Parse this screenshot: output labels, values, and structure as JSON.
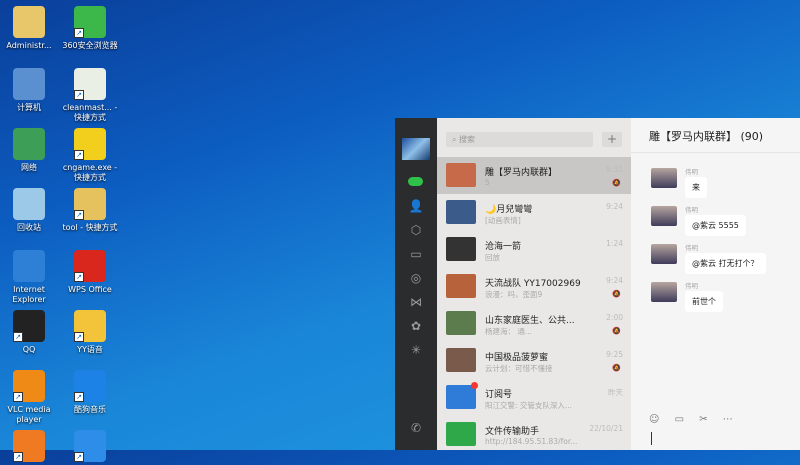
{
  "desktop": {
    "icons": [
      {
        "label": "Administr...",
        "color": "#e8c66a"
      },
      {
        "label": "360安全浏览器",
        "color": "#3cb84a"
      },
      {
        "label": "计算机",
        "color": "#5a8fd0"
      },
      {
        "label": "cleanmast... - 快捷方式",
        "color": "#e9efe5"
      },
      {
        "label": "网络",
        "color": "#3d9e57"
      },
      {
        "label": "cngame.exe - 快捷方式",
        "color": "#f1cf1c"
      },
      {
        "label": "回收站",
        "color": "#9cc9e8"
      },
      {
        "label": "tool - 快捷方式",
        "color": "#e6c25e"
      },
      {
        "label": "Internet Explorer",
        "color": "#2e7fd6"
      },
      {
        "label": "WPS Office",
        "color": "#d9271e"
      },
      {
        "label": "QQ",
        "color": "#222222"
      },
      {
        "label": "YY语音",
        "color": "#f3c43a"
      },
      {
        "label": "VLC media player",
        "color": "#f08a16"
      },
      {
        "label": "酷狗音乐",
        "color": "#1d82e6"
      },
      {
        "label": "",
        "color": "#f07a22"
      },
      {
        "label": "",
        "color": "#2d8de8"
      }
    ]
  },
  "wechat": {
    "search_placeholder": "搜索",
    "add_label": "+",
    "sidebar_icons": [
      "avatar",
      "chat-icon",
      "contacts-icon",
      "box-icon",
      "folder-icon",
      "moments-icon",
      "butterfly-icon",
      "mini-program-icon",
      "sparkle-icon",
      "phone-icon"
    ],
    "chats": [
      {
        "name": "雕【罗马内联群】",
        "preview": "5",
        "time": "9:31",
        "muted": true,
        "selected": true,
        "color": "#c76a4a"
      },
      {
        "name": "🌙月兒彎彎",
        "preview": "[动画表情]",
        "time": "9:24",
        "muted": false,
        "color": "#3b5c8a"
      },
      {
        "name": "沧海一箭",
        "preview": "回放",
        "time": "1:24",
        "muted": false,
        "color": "#333333"
      },
      {
        "name": "天流战队 YY17002969",
        "preview": "浪漫：吗，歪面9",
        "time": "9:24",
        "muted": true,
        "color": "#b8623c"
      },
      {
        "name": "山东家庭医生、公共...",
        "preview": "杨建海：          通...",
        "time": "2:00",
        "muted": true,
        "color": "#5d7c4e"
      },
      {
        "name": "中国极品菠萝蜜",
        "preview": "云计划：可惜不懂接",
        "time": "9:25",
        "muted": true,
        "color": "#7a5a4a"
      },
      {
        "name": "订阅号",
        "preview": "阳江交警: 交管支队深入...",
        "time": "昨天",
        "muted": false,
        "color": "#2f7bd8",
        "badge": true
      },
      {
        "name": "文件传输助手",
        "preview": "http://184.95.51.83/for...",
        "time": "22/10/21",
        "muted": false,
        "color": "#2fa84a"
      }
    ],
    "chat": {
      "title": "雕【罗马内联群】 (90)",
      "messages": [
        {
          "sender": "伟明",
          "text": "来"
        },
        {
          "sender": "伟明",
          "text": "@紫云 5555"
        },
        {
          "sender": "伟明",
          "text": "@紫云 打无打个？"
        },
        {
          "sender": "伟明",
          "text": "前世个"
        }
      ],
      "toolbar": "☺ ▭ ✂ ⋯"
    }
  }
}
